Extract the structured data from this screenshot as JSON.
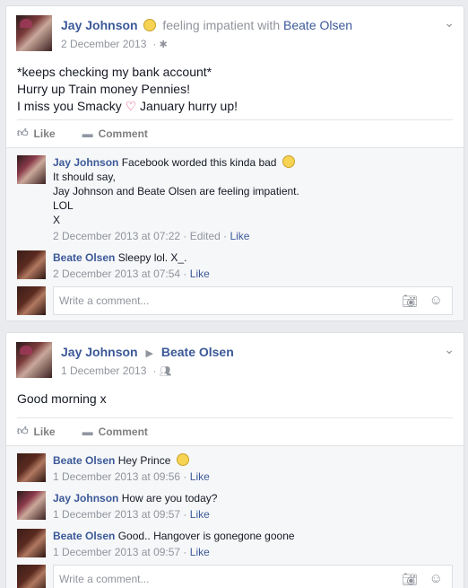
{
  "posts": [
    {
      "author": "Jay Johnson",
      "feeling": "feeling impatient with",
      "tagged": "Beate Olsen",
      "date": "2 December 2013",
      "privacy_icon": "gear-icon",
      "body_lines": [
        "*keeps checking my bank account*",
        "Hurry up Train money Pennies!",
        "I miss you Smacky",
        "January hurry up!"
      ],
      "like_label": "Like",
      "comment_label": "Comment",
      "comments": [
        {
          "author": "Jay Johnson",
          "text": "Facebook worded this kinda bad",
          "text_lines": "It should say,\nJay Johnson and Beate Olsen are feeling impatient.\nLOL\nX",
          "meta": "2 December 2013 at 07:22 · Edited · ",
          "like": "Like"
        },
        {
          "author": "Beate Olsen",
          "text": "Sleepy lol. X_.",
          "meta": "2 December 2013 at 07:54 · ",
          "like": "Like"
        }
      ],
      "write_placeholder": "Write a comment..."
    },
    {
      "author": "Jay Johnson",
      "arrow": "▶",
      "recipient": "Beate Olsen",
      "date": "1 December 2013",
      "privacy_icon": "friends-icon",
      "body": "Good morning x",
      "like_label": "Like",
      "comment_label": "Comment",
      "comments": [
        {
          "author": "Beate Olsen",
          "text": "Hey Prince",
          "meta": "1 December 2013 at 09:56 · ",
          "like": "Like"
        },
        {
          "author": "Jay Johnson",
          "text": "How are you today?",
          "meta": "1 December 2013 at 09:57 · ",
          "like": "Like"
        },
        {
          "author": "Beate Olsen",
          "text": "Good.. Hangover is gonegone goone",
          "meta": "1 December 2013 at 09:57 · ",
          "like": "Like"
        }
      ],
      "write_placeholder": "Write a comment..."
    }
  ]
}
